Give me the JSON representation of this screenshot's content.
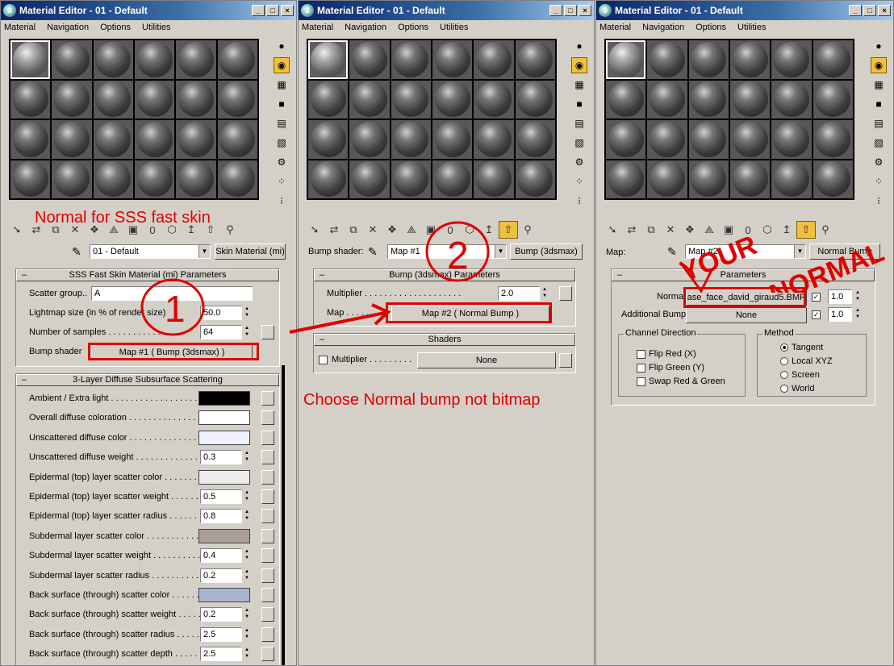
{
  "windows": [
    {
      "title": "Material Editor - 01 - Default"
    },
    {
      "title": "Material Editor - 01 - Default"
    },
    {
      "title": "Material Editor - 01 - Default"
    }
  ],
  "menu": [
    "Material",
    "Navigation",
    "Options",
    "Utilities"
  ],
  "title_buttons": {
    "minimize": "_",
    "maximize": "□",
    "close": "×"
  },
  "win1": {
    "material_name": "01 - Default",
    "material_type": "Skin Material (mi)",
    "rollout1_title": "SSS Fast Skin Material (mi) Parameters",
    "scatter_group_label": "Scatter group..",
    "scatter_group_value": "A",
    "lightmap_label": "Lightmap size (in % of render size)",
    "lightmap_value": "50.0",
    "samples_label": "Number of samples . . . . . . . . . . . . .",
    "samples_value": "64",
    "bump_label": "Bump shader",
    "bump_value": "Map #1  ( Bump (3dsmax) )",
    "rollout2_title": "3-Layer Diffuse Subsurface Scattering",
    "params": [
      {
        "label": "Ambient / Extra light . . . . . . . . . . . . . . . . . .",
        "type": "color",
        "color": "#000000"
      },
      {
        "label": "Overall diffuse coloration . . . . . . . . . . . . . . .",
        "type": "color",
        "color": "#ffffff"
      },
      {
        "label": "Unscattered diffuse color . . . . . . . . . . . . . . .",
        "type": "color",
        "color": "#f0f0ff"
      },
      {
        "label": "Unscattered diffuse weight . . . . . . . . . . . . .",
        "type": "num",
        "value": "0.3"
      },
      {
        "label": "Epidermal (top) layer scatter color . . . . . . .",
        "type": "color",
        "color": "#ececec"
      },
      {
        "label": "Epidermal (top) layer scatter weight . . . . . .",
        "type": "num",
        "value": "0.5"
      },
      {
        "label": "Epidermal (top) layer scatter radius . . . . . .",
        "type": "num",
        "value": "0.8"
      },
      {
        "label": "Subdermal layer scatter color . . . . . . . . . . . .",
        "type": "color",
        "color": "#ac9f98"
      },
      {
        "label": "Subdermal layer scatter weight . . . . . . . . . .",
        "type": "num",
        "value": "0.4"
      },
      {
        "label": "Subdermal layer scatter radius . . . . . . . . . . .",
        "type": "num",
        "value": "0.2"
      },
      {
        "label": "Back surface (through) scatter color . . . . . .",
        "type": "color",
        "color": "#a9b5d0"
      },
      {
        "label": "Back surface (through) scatter weight . . . . .",
        "type": "num",
        "value": "0.2"
      },
      {
        "label": "Back surface (through) scatter radius . . . . .",
        "type": "num",
        "value": "2.5"
      },
      {
        "label": "Back surface (through) scatter depth . . . . . .",
        "type": "num",
        "value": "2.5"
      }
    ],
    "annotation": "Normal for SSS fast skin",
    "circle_number": "1"
  },
  "win2": {
    "bump_shader_label": "Bump shader:",
    "map_name": "Map #1",
    "map_type": "Bump (3dsmax)",
    "rollout1_title": "Bump (3dsmax) Parameters",
    "multiplier_label": "Multiplier . . . . . . . . . . . . . . . . . . . .",
    "multiplier_value": "2.0",
    "map_label": "Map . . . . . . . . .",
    "map_value": "Map #2  ( Normal Bump )",
    "rollout2_title": "Shaders",
    "shader_multiplier_label": "Multiplier . . . . . . . . .",
    "shader_value": "None",
    "annotation": "Choose Normal bump not bitmap",
    "circle_number": "2"
  },
  "win3": {
    "map_label": "Map:",
    "map_name": "Map #2",
    "map_type": "Normal Bump",
    "rollout_title": "Parameters",
    "normal_label": "Normal",
    "normal_value": "ase_face_david_giraud5.BMP",
    "normal_amount": "1.0",
    "additional_bump_label": "Additional Bump:",
    "additional_bump_value": "None",
    "additional_amount": "1.0",
    "channel_group": "Channel Direction",
    "channel_options": [
      "Flip Red (X)",
      "Flip Green (Y)",
      "Swap Red & Green"
    ],
    "method_group": "Method",
    "method_options": [
      "Tangent",
      "Local XYZ",
      "Screen",
      "World"
    ],
    "method_selected": "Tangent",
    "annotation_line1": "YOUR",
    "annotation_line2": "NORMAL"
  },
  "colors": {
    "annotation_red": "#e00000",
    "title_blue": "#0a246a",
    "active_tool": "#f0c040"
  }
}
